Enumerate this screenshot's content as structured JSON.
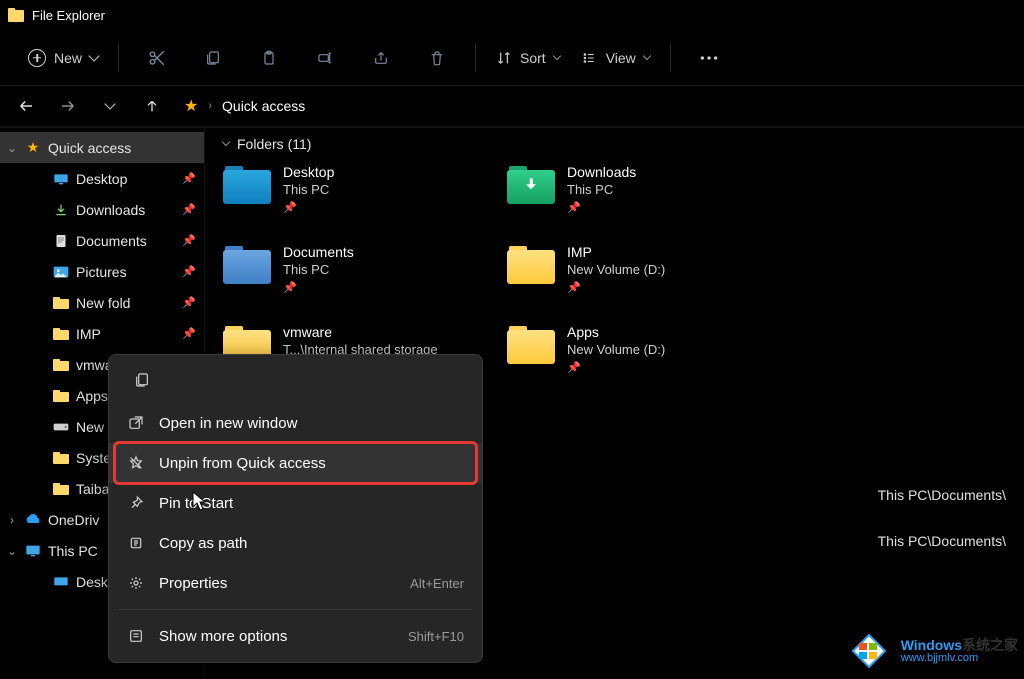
{
  "titlebar": {
    "title": "File Explorer"
  },
  "toolbar": {
    "new_label": "New",
    "sort_label": "Sort",
    "view_label": "View"
  },
  "address": {
    "location": "Quick access"
  },
  "tree": {
    "quick_access": "Quick access",
    "items": [
      {
        "label": "Desktop",
        "icon": "desktop",
        "pinned": true
      },
      {
        "label": "Downloads",
        "icon": "download",
        "pinned": true
      },
      {
        "label": "Documents",
        "icon": "document",
        "pinned": true
      },
      {
        "label": "Pictures",
        "icon": "picture",
        "pinned": true
      },
      {
        "label": "New fold",
        "icon": "folder",
        "pinned": true
      },
      {
        "label": "IMP",
        "icon": "folder",
        "pinned": true
      },
      {
        "label": "vmwar",
        "icon": "folder",
        "pinned": true
      },
      {
        "label": "Apps",
        "icon": "folder",
        "pinned": true
      },
      {
        "label": "New V",
        "icon": "drive",
        "pinned": true
      },
      {
        "label": "System",
        "icon": "folder",
        "pinned": false
      },
      {
        "label": "Taiba",
        "icon": "folder",
        "pinned": false
      }
    ],
    "onedrive": "OneDriv",
    "thispc": "This PC",
    "thispc_children": [
      {
        "label": "Deskto"
      }
    ]
  },
  "content": {
    "group_label": "Folders (11)",
    "folders": [
      {
        "name": "Desktop",
        "subtitle": "This PC",
        "style": "blue",
        "pinned": true
      },
      {
        "name": "Downloads",
        "subtitle": "This PC",
        "style": "green",
        "pinned": true
      },
      {
        "name": "Documents",
        "subtitle": "This PC",
        "style": "docs",
        "pinned": true
      },
      {
        "name": "IMP",
        "subtitle": "New Volume (D:)",
        "style": "yellow",
        "pinned": true
      },
      {
        "name": "vmware",
        "subtitle": "T...\\Internal shared storage",
        "style": "yellow",
        "pinned": true
      },
      {
        "name": "Apps",
        "subtitle": "New Volume (D:)",
        "style": "yellow",
        "pinned": true
      }
    ],
    "paths": [
      "This PC\\Documents\\",
      "This PC\\Documents\\"
    ]
  },
  "context_menu": {
    "items": [
      {
        "label": "Open in new window",
        "icon": "open-external"
      },
      {
        "label": "Unpin from Quick access",
        "icon": "star-off",
        "highlight": true
      },
      {
        "label": "Pin to Start",
        "icon": "pin"
      },
      {
        "label": "Copy as path",
        "icon": "copy-path"
      },
      {
        "label": "Properties",
        "icon": "properties",
        "shortcut": "Alt+Enter"
      }
    ],
    "more": {
      "label": "Show more options",
      "shortcut": "Shift+F10"
    }
  },
  "watermark": {
    "brand_a": "Windows",
    "brand_b": "系统之家",
    "url": "www.bjjmlv.com"
  }
}
